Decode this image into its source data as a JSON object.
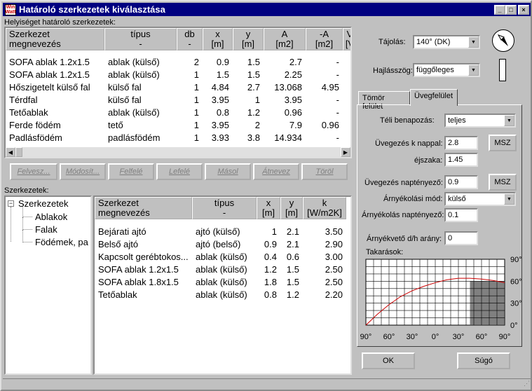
{
  "window": {
    "title": "Határoló szerkezetek kiválasztása",
    "app_icon_text": "Win Watt",
    "minimize": "_",
    "maximize": "□",
    "close": "×"
  },
  "top_section": {
    "label": "Helyiséget határoló szerkezetek:"
  },
  "top_table": {
    "headers": [
      {
        "l1": "Szerkezet",
        "l2": "megnevezés"
      },
      {
        "l1": "típus",
        "l2": "-"
      },
      {
        "l1": "db",
        "l2": "-"
      },
      {
        "l1": "x",
        "l2": "[m]"
      },
      {
        "l1": "y",
        "l2": "[m]"
      },
      {
        "l1": "A",
        "l2": "[m2]"
      },
      {
        "l1": "-A",
        "l2": "[m2]"
      },
      {
        "l1": "V",
        "l2": "[V"
      }
    ],
    "rows": [
      [
        "SOFA ablak 1.2x1.5",
        "ablak (külső)",
        "2",
        "0.9",
        "1.5",
        "2.7",
        "-"
      ],
      [
        "SOFA ablak 1.2x1.5",
        "ablak (külső)",
        "1",
        "1.5",
        "1.5",
        "2.25",
        "-"
      ],
      [
        "Hőszigetelt külső fal",
        "külső fal",
        "1",
        "4.84",
        "2.7",
        "13.068",
        "4.95"
      ],
      [
        "Térdfal",
        "külső fal",
        "1",
        "3.95",
        "1",
        "3.95",
        "-"
      ],
      [
        "Tetőablak",
        "ablak (külső)",
        "1",
        "0.8",
        "1.2",
        "0.96",
        "-"
      ],
      [
        "Ferde födém",
        "tető",
        "1",
        "3.95",
        "2",
        "7.9",
        "0.96"
      ],
      [
        "Padlásfödém",
        "padlásfödém",
        "1",
        "3.93",
        "3.8",
        "14.934",
        "-"
      ]
    ]
  },
  "buttons": {
    "insert": "Felvesz...",
    "modify": "Módosít...",
    "up": "Felfelé",
    "down": "Lefelé",
    "copy": "Másol",
    "rename": "Átnevez",
    "delete": "Töröl"
  },
  "bottom_section": {
    "label": "Szerkezetek:"
  },
  "tree": {
    "root": "Szerkezetek",
    "items": [
      "Ablakok",
      "Falak",
      "Födémek, pa"
    ]
  },
  "bottom_table": {
    "headers": [
      {
        "l1": "Szerkezet",
        "l2": "megnevezés"
      },
      {
        "l1": "típus",
        "l2": "-"
      },
      {
        "l1": "x",
        "l2": "[m]"
      },
      {
        "l1": "y",
        "l2": "[m]"
      },
      {
        "l1": "k",
        "l2": "[W/m2K]"
      }
    ],
    "rows": [
      [
        "Bejárati ajtó",
        "ajtó (külső)",
        "1",
        "2.1",
        "3.50"
      ],
      [
        "Belső ajtó",
        "ajtó (belső)",
        "0.9",
        "2.1",
        "2.90"
      ],
      [
        "Kapcsolt gerébtokos...",
        "ablak (külső)",
        "0.4",
        "0.6",
        "3.00"
      ],
      [
        "SOFA ablak 1.2x1.5",
        "ablak (külső)",
        "1.2",
        "1.5",
        "2.50"
      ],
      [
        "SOFA ablak 1.8x1.5",
        "ablak (külső)",
        "1.8",
        "1.5",
        "2.50"
      ],
      [
        "Tetőablak",
        "ablak (külső)",
        "0.8",
        "1.2",
        "2.20"
      ]
    ]
  },
  "orientation": {
    "label": "Tájolás:",
    "value": "140° (DK)"
  },
  "tilt": {
    "label": "Hajlásszög:",
    "value": "függőleges"
  },
  "tabs": {
    "solid": "Tömör felület",
    "glass": "Üvegfelület"
  },
  "glass": {
    "winter_sun_label": "Téli benapozás:",
    "winter_sun_value": "teljes",
    "glazing_day_label": "Üvegezés k nappal:",
    "glazing_day_value": "2.8",
    "night_label": "éjszaka:",
    "night_value": "1.45",
    "msz1": "MSZ",
    "solar_factor_label": "Üvegezés naptényező:",
    "solar_factor_value": "0.9",
    "msz2": "MSZ",
    "shading_mode_label": "Árnyékolási mód:",
    "shading_mode_value": "külső",
    "shading_factor_label": "Árnyékolás naptényező:",
    "shading_factor_value": "0.1",
    "shadow_ratio_label": "Árnyékvető d/h arány:",
    "shadow_ratio_value": "0",
    "obstructions_label": "Takarások:"
  },
  "chart_data": {
    "type": "line",
    "x_ticks": [
      "90°",
      "60°",
      "30°",
      "0°",
      "30°",
      "60°",
      "90°"
    ],
    "y_ticks": [
      "90°",
      "60°",
      "30°",
      "0°"
    ],
    "x": [
      -90,
      -75,
      -60,
      -45,
      -30,
      -15,
      0,
      15,
      30,
      45,
      60,
      75,
      90
    ],
    "series": [
      {
        "values": [
          0,
          15,
          28,
          39,
          47,
          53,
          58,
          62,
          64,
          64,
          63,
          61,
          58
        ]
      }
    ],
    "shaded_x_range": [
      45,
      90
    ],
    "shaded_y_range": [
      0,
      60
    ],
    "xlim": [
      -90,
      90
    ],
    "ylim": [
      0,
      90
    ],
    "grid": true,
    "line_color": "#cc0000"
  },
  "footer": {
    "ok": "OK",
    "help": "Súgó"
  }
}
